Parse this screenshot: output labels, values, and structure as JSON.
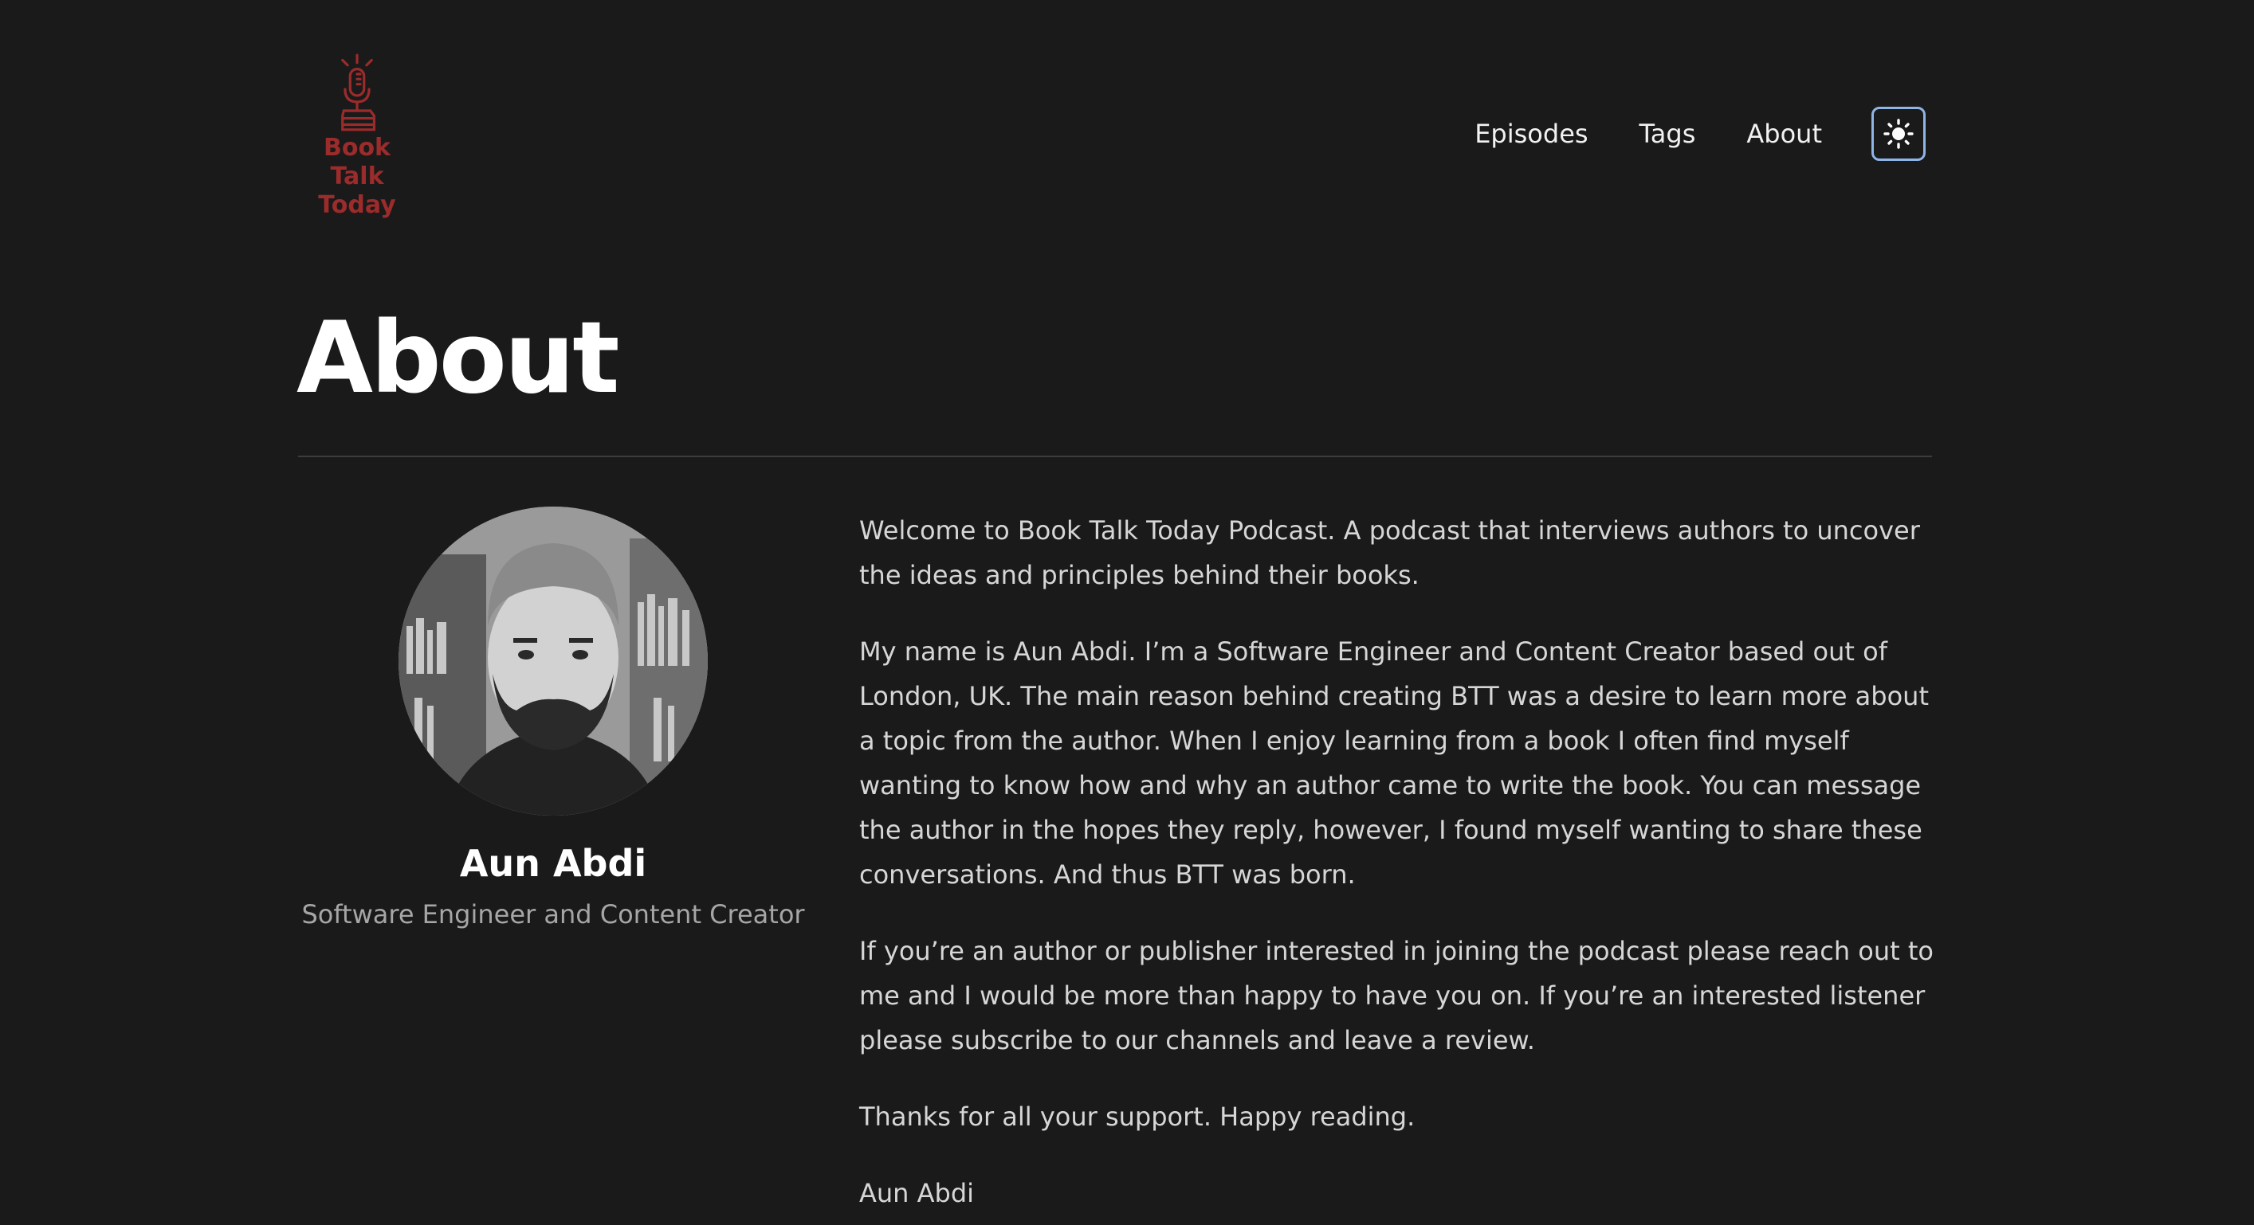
{
  "header": {
    "logo_text_line1": "Book Talk",
    "logo_text_line2": "Today",
    "nav": [
      {
        "label": "Episodes"
      },
      {
        "label": "Tags"
      },
      {
        "label": "About"
      }
    ],
    "theme_toggle_icon": "sun-icon"
  },
  "page": {
    "title": "About"
  },
  "profile": {
    "name": "Aun Abdi",
    "role": "Software Engineer and Content Creator"
  },
  "bio": {
    "paragraphs": [
      "Welcome to Book Talk Today Podcast. A podcast that interviews authors to uncover the ideas and principles behind their books.",
      "My name is Aun Abdi. I’m a Software Engineer and Content Creator based out of London, UK. The main reason behind creating BTT was a desire to learn more about a topic from the author. When I enjoy learning from a book I often find myself wanting to know how and why an author came to write the book. You can message the author in the hopes they reply, however, I found myself wanting to share these conversations. And thus BTT was born.",
      "If you’re an author or publisher interested in joining the podcast please reach out to me and I would be more than happy to have you on. If you’re an interested listener please subscribe to our channels and leave a review.",
      "Thanks for all your support. Happy reading.",
      "Aun Abdi"
    ]
  },
  "colors": {
    "background": "#1a1a1a",
    "brand_red": "#9c2b2b",
    "toggle_border": "#8fb4e6"
  }
}
